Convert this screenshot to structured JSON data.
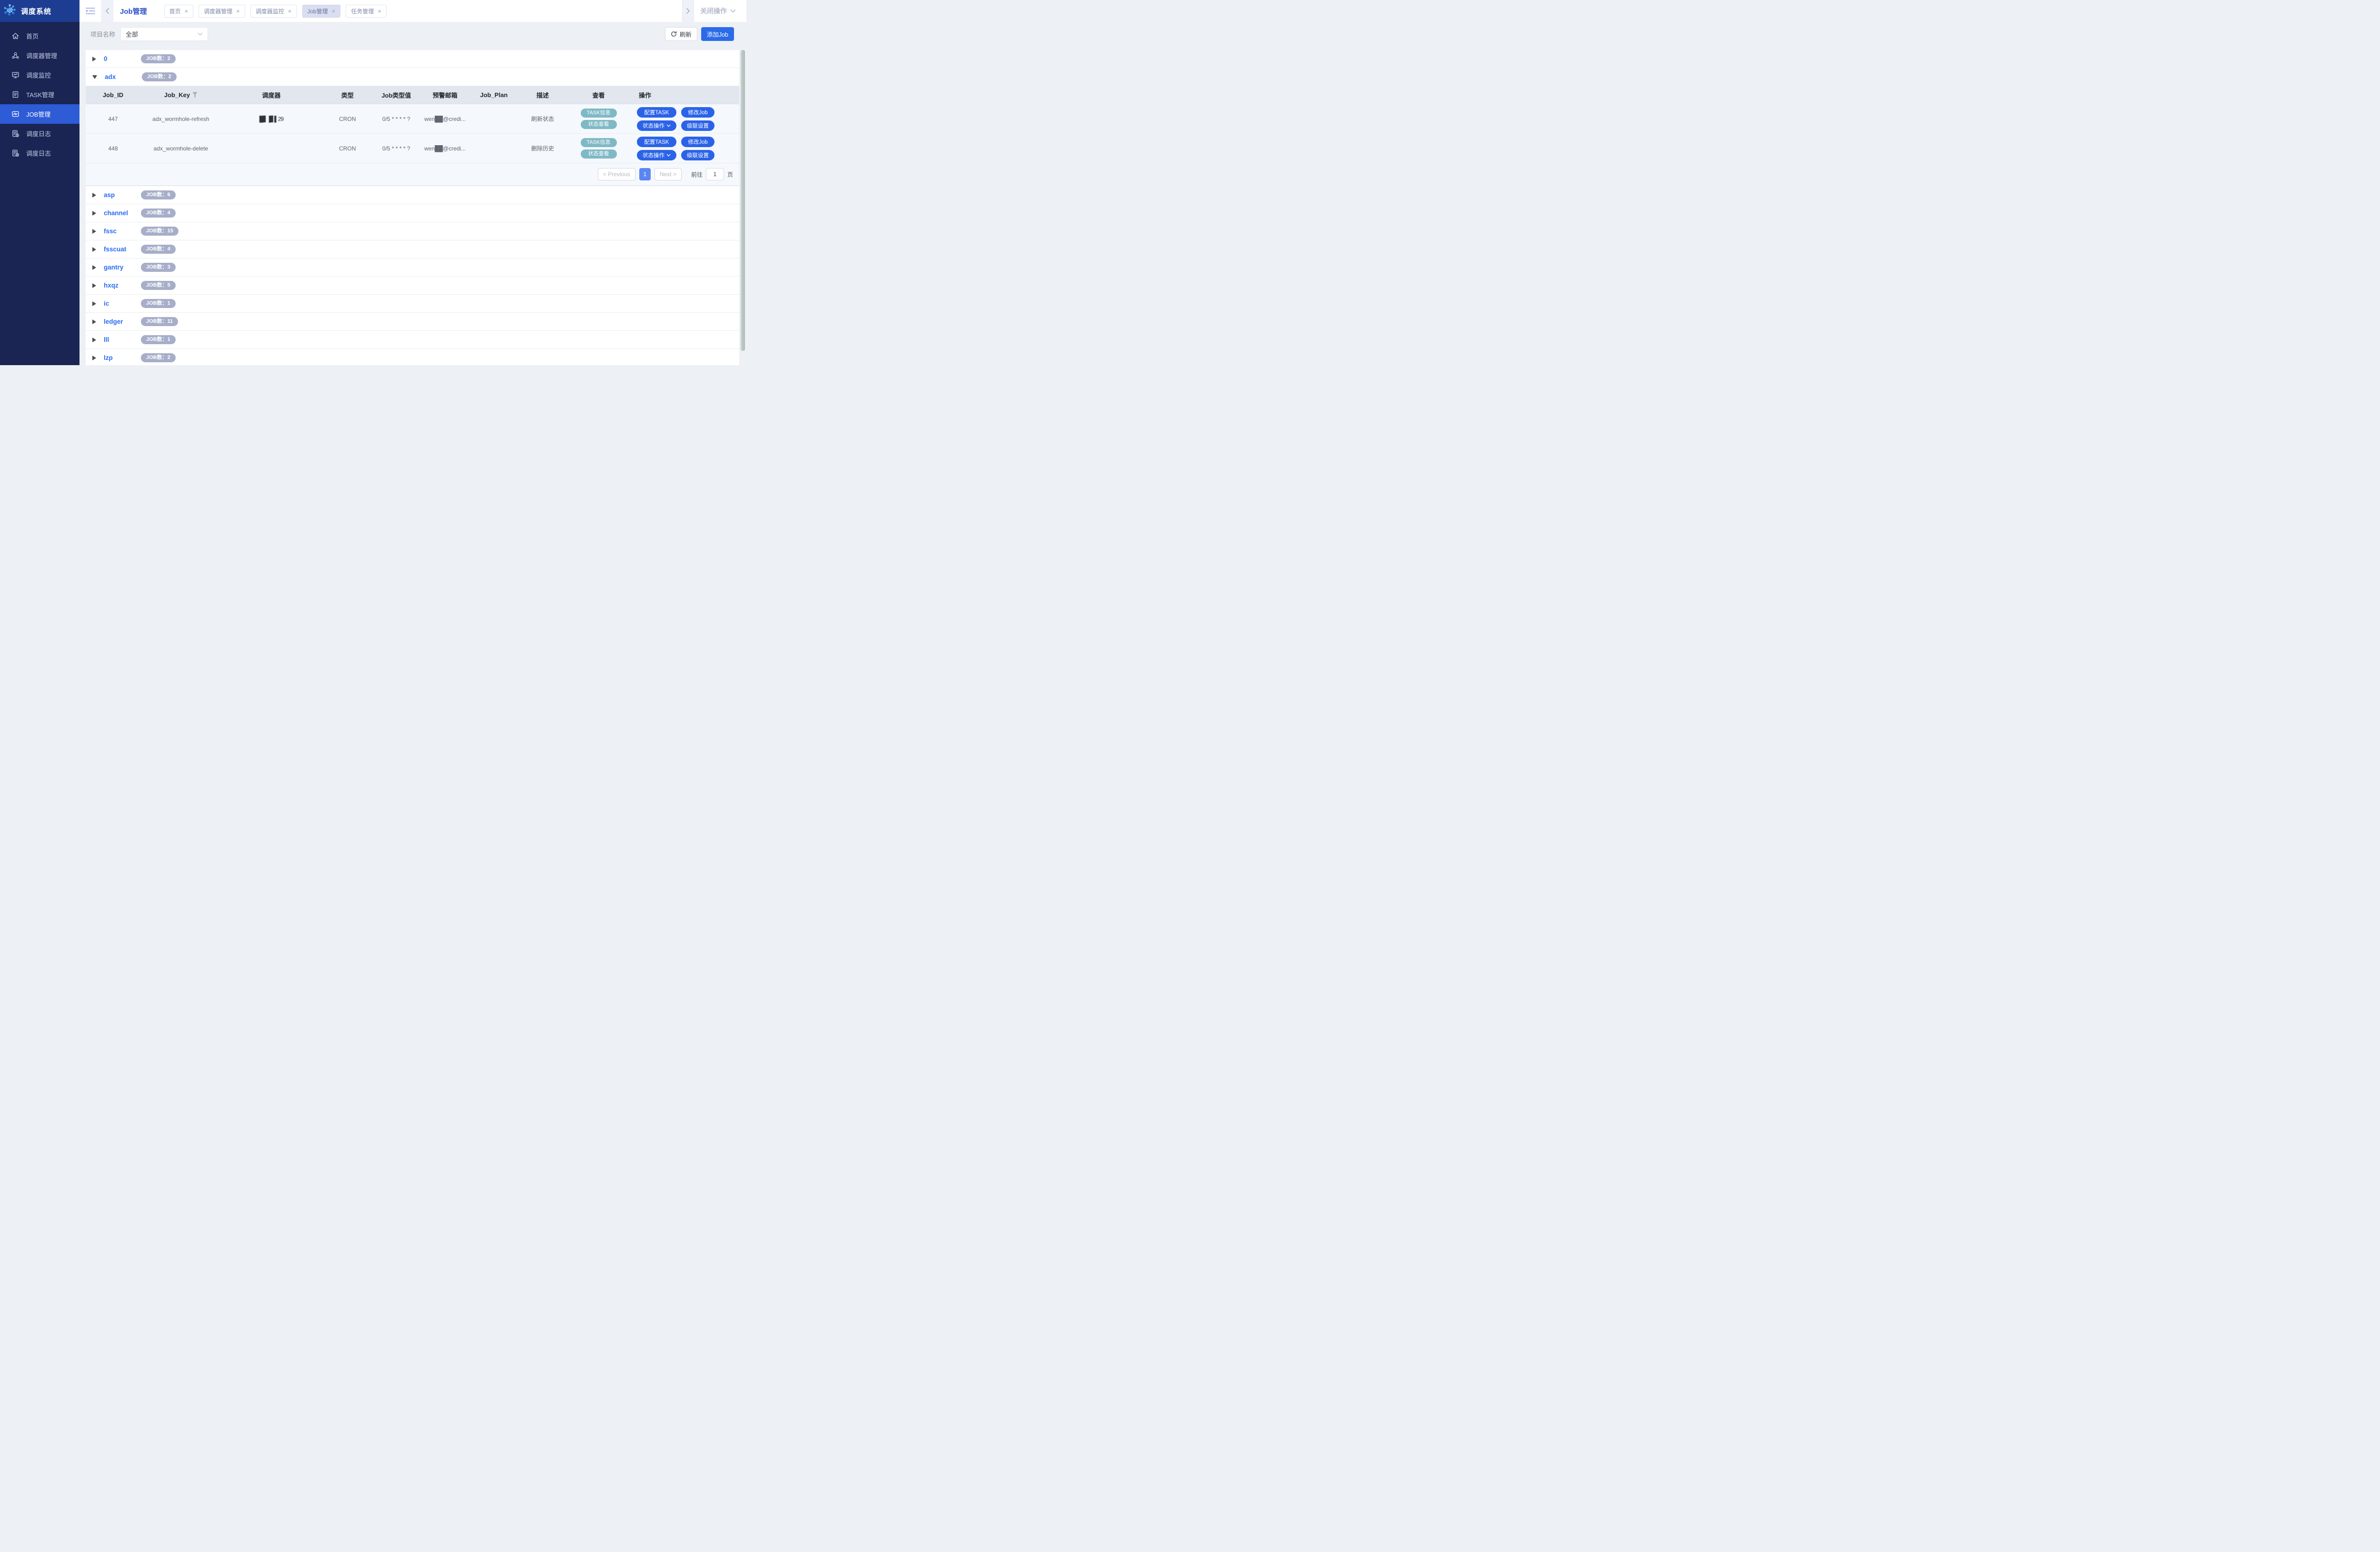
{
  "app": {
    "title": "调度系统"
  },
  "sidebar": {
    "items": [
      {
        "label": "首页",
        "icon": "home-icon"
      },
      {
        "label": "调度器管理",
        "icon": "scheduler-icon"
      },
      {
        "label": "调度监控",
        "icon": "monitor-icon"
      },
      {
        "label": "TASK管理",
        "icon": "task-icon"
      },
      {
        "label": "JOB管理",
        "icon": "job-icon",
        "active": true
      },
      {
        "label": "调度日志",
        "icon": "log-icon"
      },
      {
        "label": "调度日志",
        "icon": "log-icon"
      }
    ]
  },
  "header": {
    "page_title": "Job管理",
    "tabs": [
      {
        "label": "首页"
      },
      {
        "label": "调度器管理"
      },
      {
        "label": "调度器监控"
      },
      {
        "label": "Job管理",
        "active": true
      },
      {
        "label": "任务管理"
      }
    ],
    "close_ops_label": "关闭操作"
  },
  "filter": {
    "label": "项目名称",
    "value": "全部"
  },
  "toolbar": {
    "refresh_label": "刷新",
    "add_label": "添加Job"
  },
  "groups": [
    {
      "name": "0",
      "badge": "JOB数：2",
      "expanded": false
    },
    {
      "name": "adx",
      "badge": "JOB数：2",
      "expanded": true
    },
    {
      "name": "asp",
      "badge": "JOB数：6",
      "expanded": false
    },
    {
      "name": "channel",
      "badge": "JOB数：4",
      "expanded": false
    },
    {
      "name": "fssc",
      "badge": "JOB数：15",
      "expanded": false
    },
    {
      "name": "fsscuat",
      "badge": "JOB数：4",
      "expanded": false
    },
    {
      "name": "gantry",
      "badge": "JOB数：3",
      "expanded": false
    },
    {
      "name": "hxqz",
      "badge": "JOB数：5",
      "expanded": false
    },
    {
      "name": "ic",
      "badge": "JOB数：1",
      "expanded": false
    },
    {
      "name": "ledger",
      "badge": "JOB数：11",
      "expanded": false
    },
    {
      "name": "lll",
      "badge": "JOB数：1",
      "expanded": false
    },
    {
      "name": "lzp",
      "badge": "JOB数：2",
      "expanded": false
    }
  ],
  "table": {
    "columns": [
      "Job_ID",
      "Job_Key",
      "调度器",
      "类型",
      "Job类型值",
      "预警邮箱",
      "Job_Plan",
      "描述",
      "查看",
      "操作"
    ],
    "rows": [
      {
        "job_id": "447",
        "job_key": "adx_wormhole-refresh",
        "scheduler": "█▋▐▋▌29",
        "type": "CRON",
        "type_value": "0/5 * * * * ?",
        "email": "wen██@credi...",
        "job_plan": "",
        "desc": "刷新状态"
      },
      {
        "job_id": "448",
        "job_key": "adx_wormhole-delete",
        "scheduler": "",
        "type": "CRON",
        "type_value": "0/5 * * * * ?",
        "email": "wen██@credi...",
        "job_plan": "",
        "desc": "删除历史"
      }
    ],
    "view_buttons": [
      "TASK信息",
      "状态查看"
    ],
    "action_buttons": [
      "配置TASK",
      "修改Job",
      "状态操作",
      "级联设置"
    ]
  },
  "pagination": {
    "prev": "< Previous",
    "page": "1",
    "next": "Next >",
    "goto_label": "前往",
    "goto_value": "1",
    "unit": "页"
  }
}
